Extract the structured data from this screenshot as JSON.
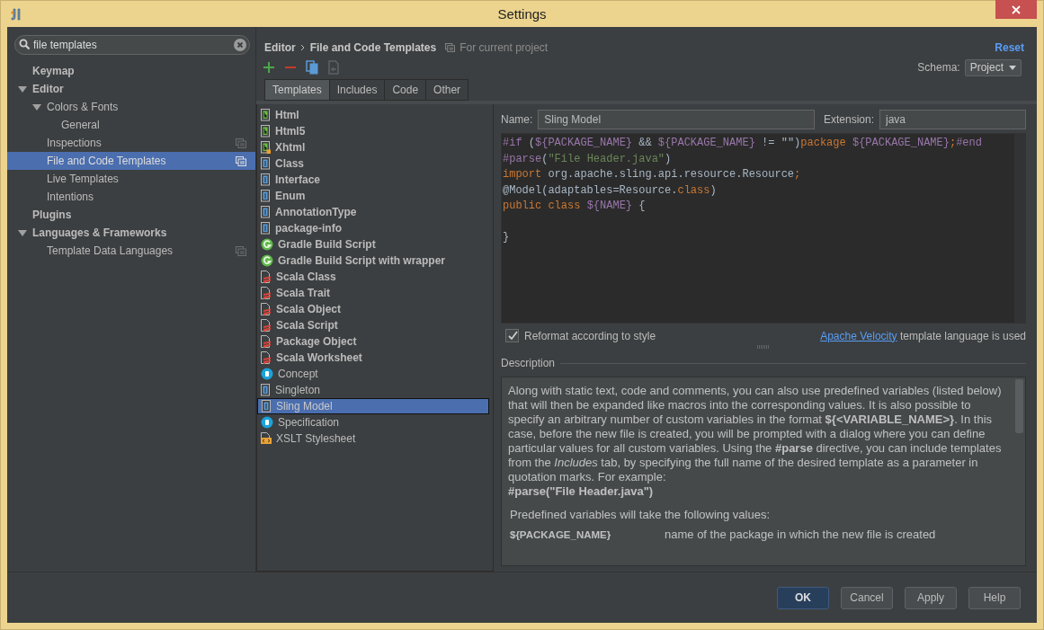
{
  "window": {
    "title": "Settings"
  },
  "search": {
    "value": "file templates"
  },
  "sidebar": {
    "items": [
      {
        "label": "Keymap",
        "selected": false,
        "project_scope": false
      },
      {
        "label": "Editor",
        "selected": false,
        "project_scope": false,
        "expanded": true,
        "children": [
          {
            "label": "Colors & Fonts",
            "selected": false,
            "project_scope": false,
            "expanded": true,
            "children": [
              {
                "label": "General",
                "selected": false,
                "project_scope": false
              }
            ]
          },
          {
            "label": "Inspections",
            "selected": false,
            "project_scope": true
          },
          {
            "label": "File and Code Templates",
            "selected": true,
            "project_scope": true
          },
          {
            "label": "Live Templates",
            "selected": false,
            "project_scope": false
          },
          {
            "label": "Intentions",
            "selected": false,
            "project_scope": false
          }
        ]
      },
      {
        "label": "Plugins",
        "selected": false,
        "project_scope": false
      },
      {
        "label": "Languages & Frameworks",
        "selected": false,
        "project_scope": false,
        "expanded": true,
        "children": [
          {
            "label": "Template Data Languages",
            "selected": false,
            "project_scope": true
          }
        ]
      }
    ]
  },
  "breadcrumb": {
    "path": [
      "Editor",
      "File and Code Templates"
    ],
    "scope_note": "For current project",
    "reset": "Reset"
  },
  "toolbar": [
    {
      "kind": "add",
      "disabled": false
    },
    {
      "kind": "remove",
      "disabled": false
    },
    {
      "kind": "copy",
      "disabled": false
    },
    {
      "kind": "reset",
      "disabled": true
    }
  ],
  "schema": {
    "label": "Schema:",
    "value": "Project"
  },
  "tabs": [
    {
      "label": "Templates",
      "selected": true
    },
    {
      "label": "Includes",
      "selected": false
    },
    {
      "label": "Code",
      "selected": false
    },
    {
      "label": "Other",
      "selected": false
    }
  ],
  "templates": [
    {
      "label": "Html",
      "kind": "html",
      "bold": true,
      "selected": false
    },
    {
      "label": "Html5",
      "kind": "html",
      "bold": true,
      "selected": false
    },
    {
      "label": "Xhtml",
      "kind": "xhtml",
      "bold": true,
      "selected": false
    },
    {
      "label": "Class",
      "kind": "java",
      "bold": true,
      "selected": false
    },
    {
      "label": "Interface",
      "kind": "java",
      "bold": true,
      "selected": false
    },
    {
      "label": "Enum",
      "kind": "java",
      "bold": true,
      "selected": false
    },
    {
      "label": "AnnotationType",
      "kind": "java",
      "bold": true,
      "selected": false
    },
    {
      "label": "package-info",
      "kind": "java",
      "bold": true,
      "selected": false
    },
    {
      "label": "Gradle Build Script",
      "kind": "gradle",
      "bold": true,
      "selected": false
    },
    {
      "label": "Gradle Build Script with wrapper",
      "kind": "gradle",
      "bold": true,
      "selected": false
    },
    {
      "label": "Scala Class",
      "kind": "scala",
      "bold": true,
      "selected": false
    },
    {
      "label": "Scala Trait",
      "kind": "scala",
      "bold": true,
      "selected": false
    },
    {
      "label": "Scala Object",
      "kind": "scala",
      "bold": true,
      "selected": false
    },
    {
      "label": "Scala Script",
      "kind": "scala",
      "bold": true,
      "selected": false
    },
    {
      "label": "Package Object",
      "kind": "scala",
      "bold": true,
      "selected": false
    },
    {
      "label": "Scala Worksheet",
      "kind": "scala",
      "bold": true,
      "selected": false
    },
    {
      "label": "Concept",
      "kind": "concept",
      "bold": false,
      "selected": false
    },
    {
      "label": "Singleton",
      "kind": "java",
      "bold": false,
      "selected": false
    },
    {
      "label": "Sling Model",
      "kind": "java",
      "bold": false,
      "selected": true
    },
    {
      "label": "Specification",
      "kind": "concept",
      "bold": false,
      "selected": false
    },
    {
      "label": "XSLT Stylesheet",
      "kind": "xslt",
      "bold": false,
      "selected": false
    }
  ],
  "editor": {
    "name_label": "Name:",
    "name": "Sling Model",
    "extension_label": "Extension:",
    "extension": "java",
    "code": [
      {
        "kind": "directive",
        "text": "#if"
      },
      {
        "kind": "plain",
        "text": " ("
      },
      {
        "kind": "variable",
        "text": "${PACKAGE_NAME}"
      },
      {
        "kind": "plain",
        "text": " && "
      },
      {
        "kind": "variable",
        "text": "${PACKAGE_NAME}"
      },
      {
        "kind": "plain",
        "text": " != \"\")"
      },
      {
        "kind": "keyword",
        "text": "package "
      },
      {
        "kind": "variable",
        "text": "${PACKAGE_NAME}"
      },
      {
        "kind": "keyword",
        "text": ";"
      },
      {
        "kind": "directive",
        "text": "#end\n#parse"
      },
      {
        "kind": "plain",
        "text": "("
      },
      {
        "kind": "string",
        "text": "\"File Header.java\""
      },
      {
        "kind": "plain",
        "text": ")\n"
      },
      {
        "kind": "keyword",
        "text": "import"
      },
      {
        "kind": "plain",
        "text": " org.apache.sling.api.resource.Resource"
      },
      {
        "kind": "keyword",
        "text": ";"
      },
      {
        "kind": "plain",
        "text": "\n@Model(adaptables=Resource."
      },
      {
        "kind": "keyword",
        "text": "class"
      },
      {
        "kind": "plain",
        "text": ")\n"
      },
      {
        "kind": "keyword",
        "text": "public class "
      },
      {
        "kind": "variable",
        "text": "${NAME}"
      },
      {
        "kind": "plain",
        "text": " {\n\n}"
      }
    ]
  },
  "reformat": {
    "label": "Reformat according to style",
    "checked": true
  },
  "language_note": {
    "link": "Apache Velocity",
    "text": "template language is used"
  },
  "description": {
    "title": "Description",
    "text": "Along with static text, code and comments, you can also use predefined variables (listed below) that will then be expanded like macros into the corresponding values. It is also possible to specify an arbitrary number of custom variables in the format **${<VARIABLE_NAME>}**. In this case, before the new file is created, you will be prompted with a dialog where you can define particular values for all custom variables. Using the **#parse** directive, you can include templates from the *Includes* tab, by specifying the full name of the desired template as a parameter in quotation marks. For example:",
    "example": "#parse(\"File Header.java\")",
    "intro": "Predefined variables will take the following values:",
    "variables": [
      {
        "name": "${PACKAGE_NAME}",
        "meaning": "name of the package in which the new file is created"
      }
    ]
  },
  "buttons": [
    {
      "label": "OK",
      "default": true
    },
    {
      "label": "Cancel",
      "default": false
    },
    {
      "label": "Apply",
      "default": false
    },
    {
      "label": "Help",
      "default": false
    }
  ]
}
